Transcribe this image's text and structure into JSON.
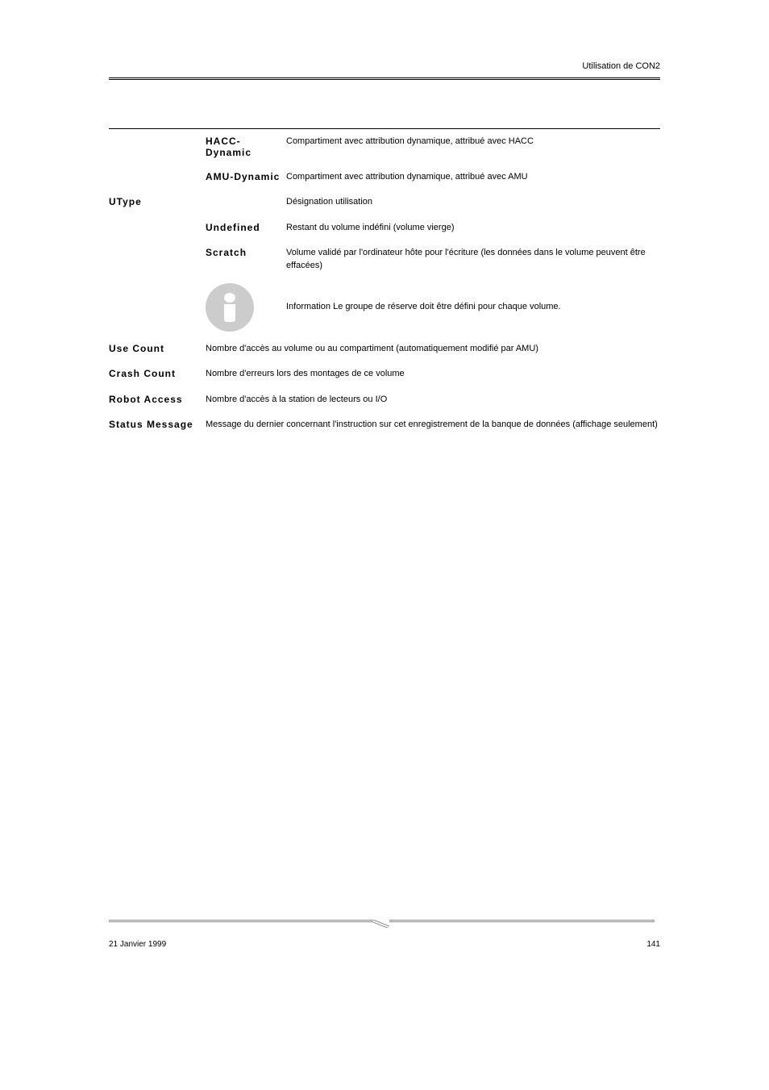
{
  "header": {
    "title": "Utilisation de CON2"
  },
  "rows": [
    {
      "field": "",
      "sub": "HACC-Dynamic",
      "desc": "Compartiment avec attribution dynamique, attribué avec HACC"
    },
    {
      "field": "",
      "sub": "AMU-Dynamic",
      "desc": "Compartiment avec attribution dynamique, attribué avec AMU"
    },
    {
      "field": "UType",
      "sub": "",
      "desc": "Désignation utilisation"
    },
    {
      "field": "",
      "sub": "Undefined",
      "desc": "Restant du volume indéfini (volume vierge)"
    },
    {
      "field": "",
      "sub": "Scratch",
      "desc": "Volume validé par l'ordinateur hôte pour l'écriture (les données dans le volume peuvent être effacées)"
    }
  ],
  "info_text": "Information Le groupe de réserve doit être défini pour chaque volume.",
  "fields": [
    {
      "label": "Use Count",
      "desc": "Nombre d'accès au volume ou au compartiment (automatiquement modifié par AMU)"
    },
    {
      "label": "Crash Count",
      "desc": "Nombre d'erreurs lors des montages de ce volume"
    },
    {
      "label": "Robot Access",
      "desc": "Nombre d'accès à la station de lecteurs ou I/O"
    },
    {
      "label": "Status Message",
      "desc": "Message du dernier concernant l'instruction sur cet enregistrement de la banque de données (affichage seulement)"
    }
  ],
  "footer": {
    "left": "21 Janvier 1999",
    "right": "141"
  }
}
